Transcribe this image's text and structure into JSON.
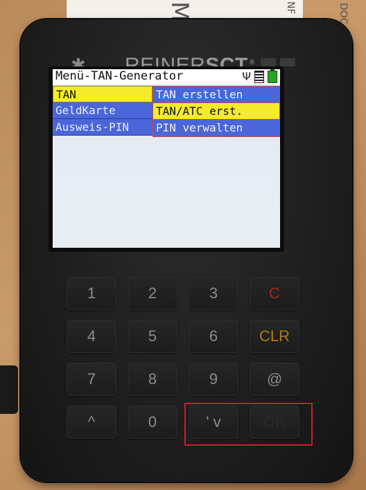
{
  "background": {
    "paper_glyphs": [
      "M",
      "NF",
      "DOC"
    ]
  },
  "device": {
    "brand_light": "REINER",
    "brand_bold": "SCT",
    "brand_mark": "®",
    "bluetooth_icon": "bluetooth-icon"
  },
  "screen": {
    "title": "Menü-TAN-Generator",
    "status_icons": [
      "usb-icon",
      "card-icon",
      "battery-icon"
    ],
    "menu": [
      {
        "label": "TAN",
        "selected": true
      },
      {
        "label": "GeldKarte",
        "selected": false
      },
      {
        "label": "Ausweis-PIN",
        "selected": false
      }
    ],
    "submenu": [
      {
        "label": "TAN erstellen",
        "highlighted": false
      },
      {
        "label": "TAN/ATC erst.",
        "highlighted": true
      },
      {
        "label": "PIN verwalten",
        "highlighted": false
      }
    ]
  },
  "keypad": {
    "keys": [
      {
        "label": "1"
      },
      {
        "label": "2"
      },
      {
        "label": "3"
      },
      {
        "label": "C"
      },
      {
        "label": "4"
      },
      {
        "label": "5"
      },
      {
        "label": "6"
      },
      {
        "label": "CLR"
      },
      {
        "label": "7"
      },
      {
        "label": "8"
      },
      {
        "label": "9"
      },
      {
        "label": "@"
      },
      {
        "label": "^"
      },
      {
        "label": "0"
      },
      {
        "label": "' v"
      },
      {
        "label": "OK"
      }
    ]
  },
  "colors": {
    "selected_yellow": "#f4ec2a",
    "menu_blue": "#4a66d8",
    "submenu_border": "#d6433e",
    "annotation_red": "#d9162a",
    "key_red": "#a3241c",
    "key_orange": "#b07a1a"
  }
}
